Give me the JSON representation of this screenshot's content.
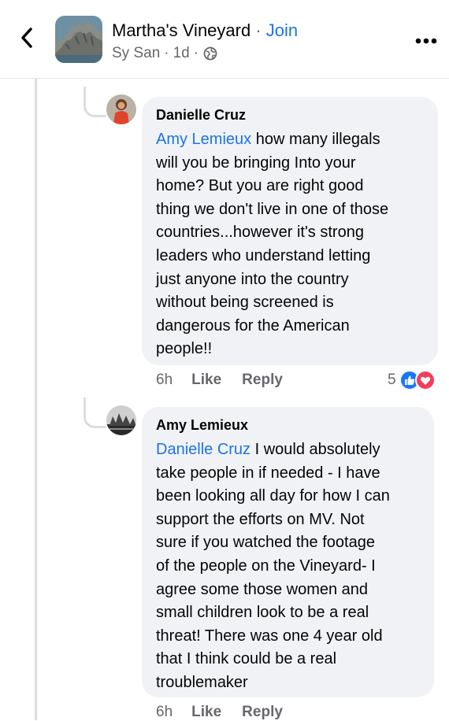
{
  "header": {
    "group_name": "Martha's Vineyard",
    "separator": "·",
    "join_label": "Join",
    "author": "Sy San",
    "time": "1d",
    "sub_separator": "·",
    "back_icon": "chevron-left-icon",
    "more_icon": "more-horizontal-icon",
    "privacy_icon": "globe-icon"
  },
  "comments": [
    {
      "author": "Danielle Cruz",
      "mention": "Amy Lemieux",
      "lines": [
        " how many illegals",
        "will you be bringing Into your",
        "home? But you are right good",
        "thing we don't live in one of those",
        "countries...however it's strong",
        "leaders who understand letting",
        "just anyone into the country",
        "without being screened is",
        "dangerous for the American",
        "people!!"
      ],
      "time": "6h",
      "like_label": "Like",
      "reply_label": "Reply",
      "reaction_count": "5",
      "reaction_icons": [
        "like-icon",
        "love-icon"
      ]
    },
    {
      "author": "Amy Lemieux",
      "mention": "Danielle Cruz",
      "lines": [
        " I would absolutely",
        "take people in if needed - I have",
        "been looking all day for how I can",
        "support the efforts on MV.  Not",
        "sure if you watched the footage",
        "of the people on the Vineyard- I",
        "agree some those women and",
        "small children look to be a real",
        "threat!  There was one 4 year old",
        "that I think could be a real",
        "troublemaker"
      ],
      "time": "6h",
      "like_label": "Like",
      "reply_label": "Reply"
    }
  ],
  "colors": {
    "accent": "#1b74e4",
    "bubble": "#f0f2f5",
    "secondary_text": "#65676b",
    "like_blue": "#1877f2",
    "love_red": "#f33e58"
  }
}
